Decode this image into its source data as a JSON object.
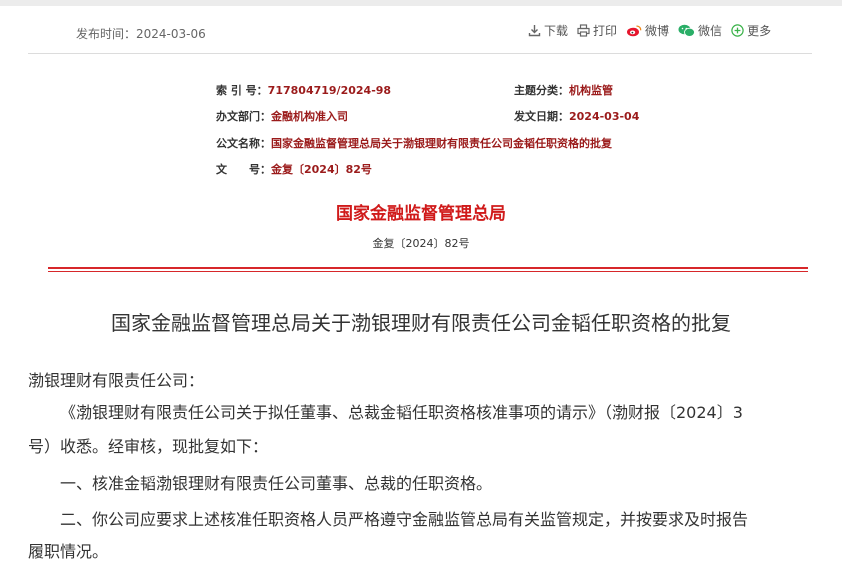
{
  "header": {
    "publish_date": "发布时间：2024-03-06",
    "tools": {
      "download": "下载",
      "print": "打印",
      "weibo": "微博",
      "wechat": "微信",
      "more": "更多"
    }
  },
  "meta": {
    "index_label": "索 引 号：",
    "index_value": "717804719/2024-98",
    "category_label": "主题分类：",
    "category_value": "机构监管",
    "dept_label": "办文部门：",
    "dept_value": "金融机构准入司",
    "date_label": "发文日期：",
    "date_value": "2024-03-04",
    "name_label": "公文名称：",
    "name_value": "国家金融监督管理总局关于渤银理财有限责任公司金韬任职资格的批复",
    "docno_label": "文　　号：",
    "docno_value": "金复〔2024〕82号"
  },
  "document": {
    "org_title": "国家金融监督管理总局",
    "doc_number": "金复〔2024〕82号",
    "title": "国家金融监督管理总局关于渤银理财有限责任公司金韬任职资格的批复",
    "salutation": "渤银理财有限责任公司：",
    "para1_line1": "《渤银理财有限责任公司关于拟任董事、总裁金韬任职资格核准事项的请示》（渤财报〔2024〕3",
    "para1_line2": "号）收悉。经审核，现批复如下：",
    "item1": "一、核准金韬渤银理财有限责任公司董事、总裁的任职资格。",
    "item2_line1": "二、你公司应要求上述核准任职资格人员严格遵守金融监管总局有关监管规定，并按要求及时报告",
    "item2_line2": "履职情况。"
  },
  "colors": {
    "accent_red": "#d01a1a",
    "meta_value": "#9b1b1b",
    "weibo": "#e6162d",
    "wechat": "#2aae67",
    "more": "#3bb24a"
  }
}
